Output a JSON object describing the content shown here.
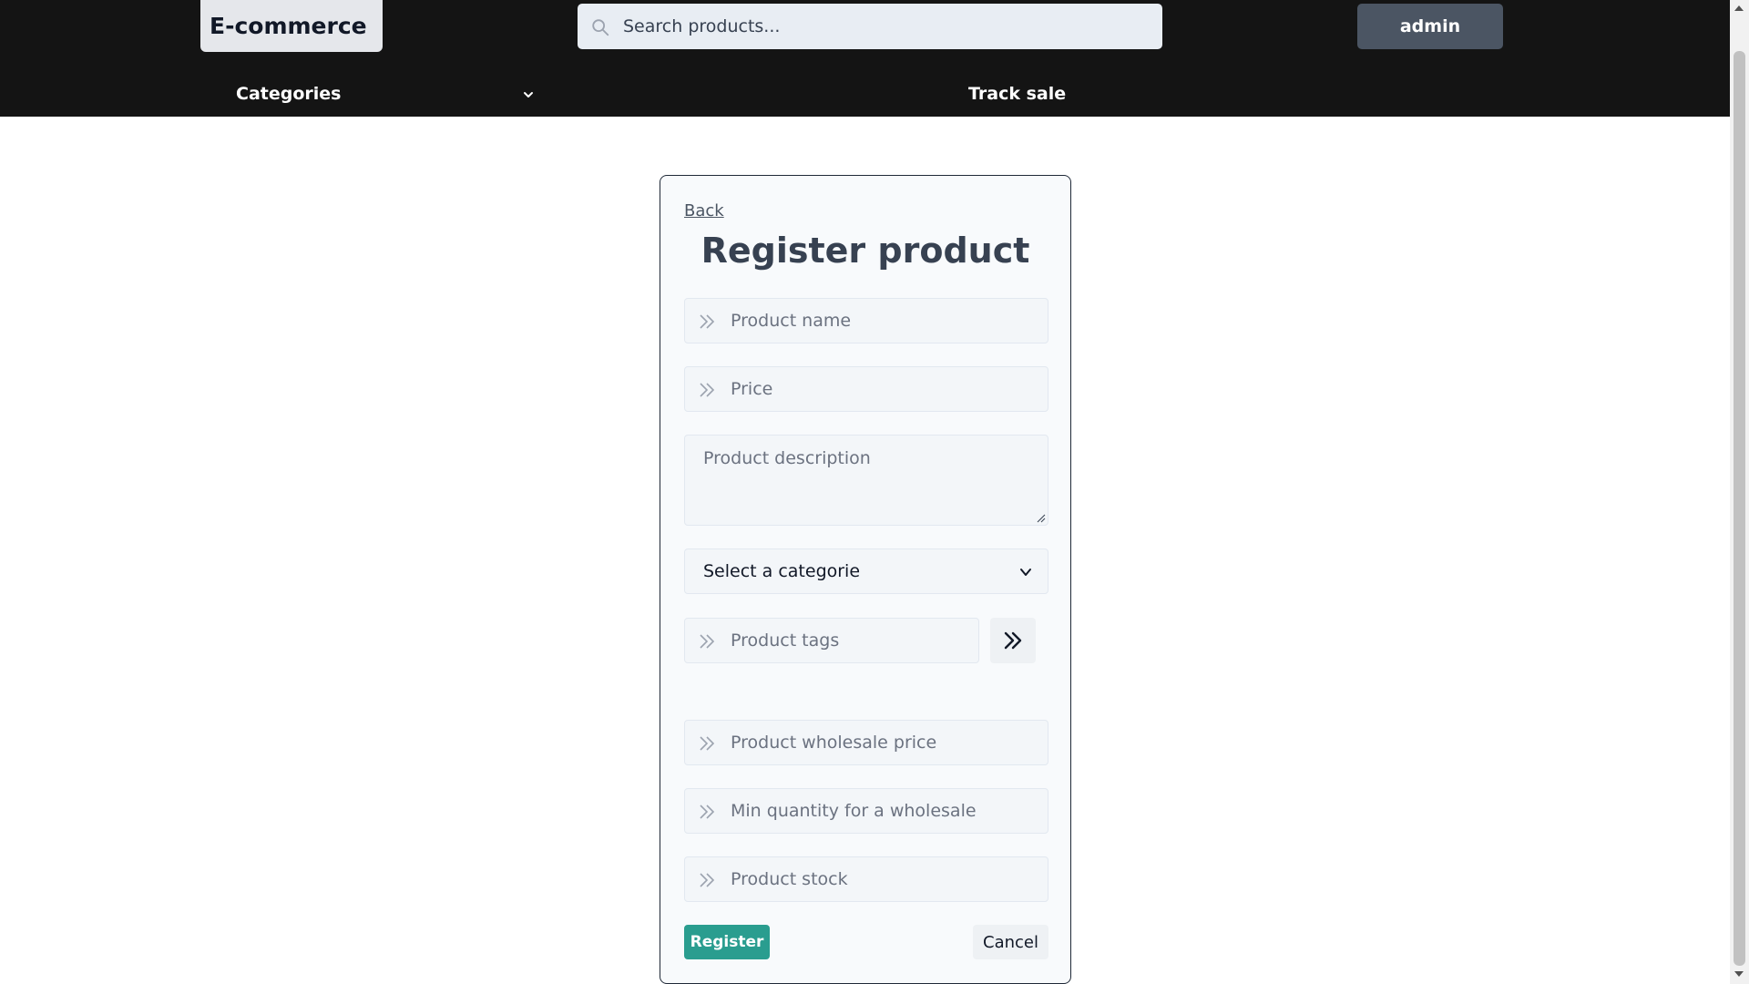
{
  "header": {
    "logo": "E-commerce",
    "search_placeholder": "Search products...",
    "user_button": "admin",
    "nav": {
      "categories": "Categories",
      "track_sale": "Track sale"
    }
  },
  "form": {
    "back_link": "Back",
    "title": "Register product",
    "fields": {
      "product_name": "Product name",
      "price": "Price",
      "description": "Product description",
      "category_select": "Select a categorie",
      "tags": "Product tags",
      "wholesale_price": "Product wholesale price",
      "min_wholesale_qty": "Min quantity for a wholesale",
      "stock": "Product stock"
    },
    "register_button": "Register",
    "cancel_button": "Cancel"
  },
  "colors": {
    "header_bg": "#141414",
    "accent": "#2a9d8f",
    "admin_button": "#4b5563"
  }
}
